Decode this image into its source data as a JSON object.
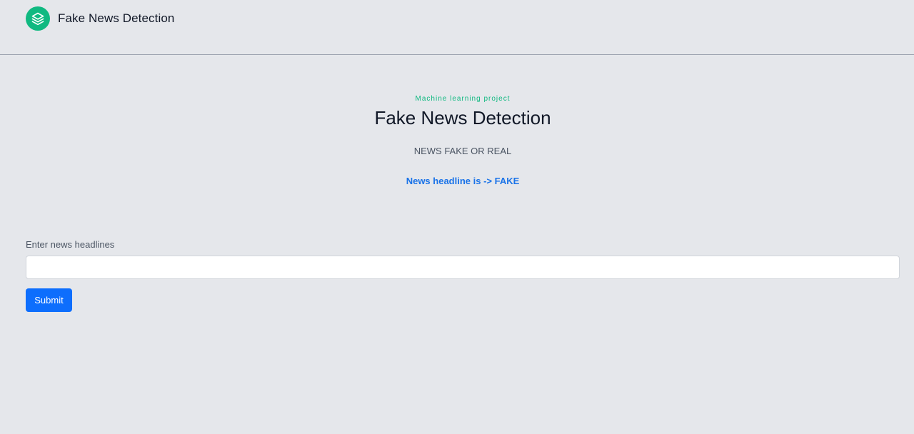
{
  "navbar": {
    "brand_title": "Fake News Detection",
    "logo_icon": "stacked-layers-icon",
    "accent_color": "#10b981"
  },
  "hero": {
    "eyebrow": "Machine learning project",
    "title": "Fake News Detection",
    "subtitle": "NEWS FAKE OR REAL",
    "result": "News headline is -> FAKE"
  },
  "form": {
    "label": "Enter news headlines",
    "input_value": "",
    "submit_label": "Submit",
    "button_color": "#0d6efd"
  }
}
